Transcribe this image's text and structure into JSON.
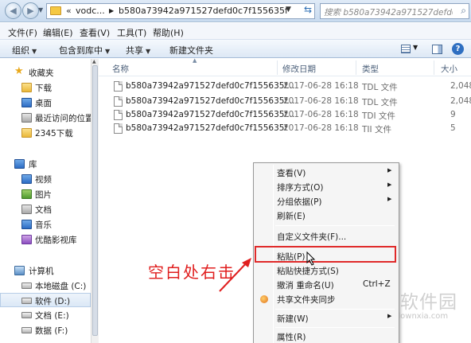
{
  "address_bar": {
    "back_label": "◀",
    "forward_label": "▶",
    "chevron": "«",
    "segment_1": "vodc...",
    "separator": "▶",
    "segment_2": "b580a73942a971527defd0c7f155635f",
    "refresh_icon": "refresh-icon"
  },
  "search": {
    "placeholder": "搜索 b580a73942a971527defd0c7f155635f"
  },
  "menu_bar": {
    "items": [
      "文件(F)",
      "编辑(E)",
      "查看(V)",
      "工具(T)",
      "帮助(H)"
    ]
  },
  "toolbar": {
    "organize": "组织",
    "include_in_library": "包含到库中",
    "share": "共享",
    "new_folder": "新建文件夹"
  },
  "nav_pane": {
    "favorites": "收藏夹",
    "downloads": "下载",
    "desktop": "桌面",
    "recent": "最近访问的位置",
    "d2345": "2345下载",
    "libraries": "库",
    "videos": "视频",
    "pictures": "图片",
    "documents": "文档",
    "music": "音乐",
    "youku": "优酷影视库",
    "computer": "计算机",
    "drive_c": "本地磁盘 (C:)",
    "drive_d": "软件 (D:)",
    "drive_e": "文档 (E:)",
    "drive_f": "数据 (F:)"
  },
  "columns": {
    "name": "名称",
    "modified": "修改日期",
    "type": "类型",
    "size": "大小"
  },
  "files": [
    {
      "name": "b580a73942a971527defd0c7f155635f...",
      "date": "2017-06-28 16:18",
      "type": "TDL 文件",
      "size": "2,048"
    },
    {
      "name": "b580a73942a971527defd0c7f155635f...",
      "date": "2017-06-28 16:18",
      "type": "TDL 文件",
      "size": "2,048"
    },
    {
      "name": "b580a73942a971527defd0c7f155635f...",
      "date": "2017-06-28 16:18",
      "type": "TDI 文件",
      "size": "9"
    },
    {
      "name": "b580a73942a971527defd0c7f155635f",
      "date": "2017-06-28 16:18",
      "type": "TII 文件",
      "size": "5"
    }
  ],
  "context_menu": {
    "view": "查看(V)",
    "sort": "排序方式(O)",
    "group": "分组依据(P)",
    "refresh": "刷新(E)",
    "customize": "自定义文件夹(F)...",
    "paste": "粘贴(P)",
    "paste_shortcut": "粘贴快捷方式(S)",
    "undo_rename": "撤消 重命名(U)",
    "undo_shortcut": "Ctrl+Z",
    "share_sync": "共享文件夹同步",
    "new": "新建(W)",
    "properties": "属性(R)"
  },
  "annotation": {
    "text": "空白处右击",
    "color": "#e01e1e"
  },
  "watermark": {
    "text": "当下软件园",
    "url": "www.downxia.com"
  }
}
